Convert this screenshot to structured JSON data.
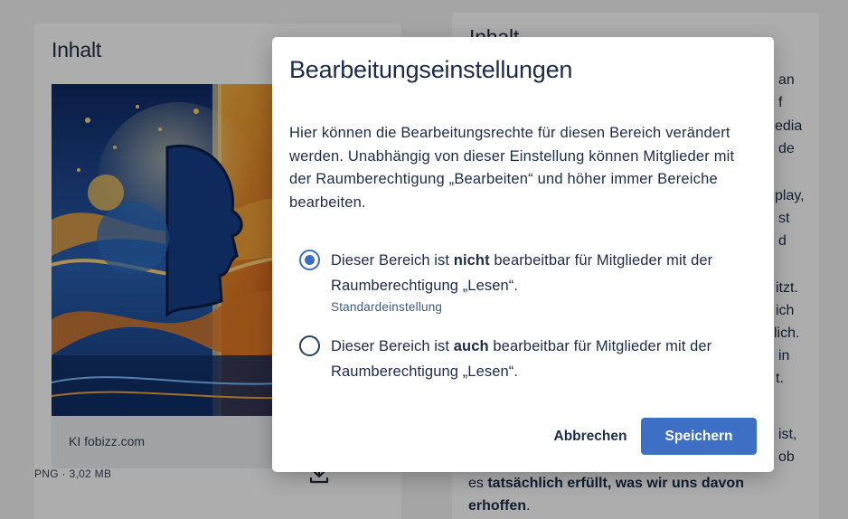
{
  "left_card": {
    "title": "Inhalt",
    "image_caption": "KI fobizz.com",
    "file_meta": "PNG · 3,02 MB",
    "download_icon": "download-icon"
  },
  "right_card": {
    "title": "Inhalt",
    "fragments": {
      "f1": "an",
      "f2": "f",
      "f3": "edia",
      "f4": "de",
      "f5": "play,",
      "f6": "st",
      "f7": "d",
      "f8": "itzt.",
      "f9": "ich",
      "f10": "lich.",
      "f11": "in",
      "f12": "t.",
      "f13": "ist,",
      "f14": "ob"
    },
    "last_line_1_prefix": "es ",
    "last_line_1_bold": "tatsächlich erfüllt, was wir uns davon",
    "last_line_2_bold": "erhoffen",
    "last_line_2_suffix": "."
  },
  "dialog": {
    "title": "Bearbeitungseinstellungen",
    "description": "Hier können die Bearbeitungsrechte für diesen Bereich verändert werden. Unabhängig von dieser Einstellung können Mitglieder mit der Raumberechtigung „Bearbeiten“ und höher immer Bereiche bearbeiten.",
    "options": [
      {
        "prefix": "Dieser Bereich ist ",
        "bold": "nicht",
        "suffix": " bearbeitbar für Mitglieder mit der Raumberechtigung „Lesen“.",
        "hint": "Standardeinstellung",
        "selected": true
      },
      {
        "prefix": "Dieser Bereich ist ",
        "bold": "auch",
        "suffix": " bearbeitbar für Mitglieder mit der Raumberechtigung „Lesen“.",
        "selected": false
      }
    ],
    "cancel_label": "Abbrechen",
    "save_label": "Speichern"
  },
  "colors": {
    "primary": "#3d6fc4",
    "text": "#1c2b4a",
    "scrim": "rgba(0,0,0,0.32)"
  }
}
